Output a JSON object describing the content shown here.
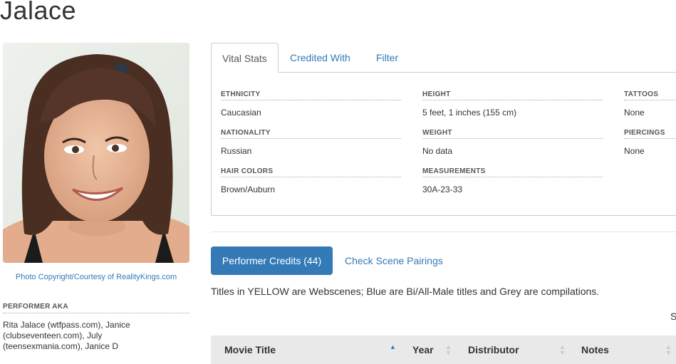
{
  "page": {
    "title": "Jalace"
  },
  "photo": {
    "credit": "Photo Copyright/Courtesy of RealityKings.com"
  },
  "aka": {
    "heading": "PERFORMER AKA",
    "text": "Rita Jalace (wtfpass.com), Janice (clubseventeen.com), July (teensexmania.com), Janice D"
  },
  "tabs": [
    "Vital Stats",
    "Credited With",
    "Filter"
  ],
  "vital_stats": {
    "ethnicity": {
      "label": "ETHNICITY",
      "value": "Caucasian"
    },
    "nationality": {
      "label": "NATIONALITY",
      "value": "Russian"
    },
    "hair_colors": {
      "label": "HAIR COLORS",
      "value": "Brown/Auburn"
    },
    "height": {
      "label": "HEIGHT",
      "value": "5 feet, 1 inches (155 cm)"
    },
    "weight": {
      "label": "WEIGHT",
      "value": "No data"
    },
    "measurements": {
      "label": "MEASUREMENTS",
      "value": "30A-23-33"
    },
    "tattoos": {
      "label": "TATTOOS",
      "value": "None"
    },
    "piercings": {
      "label": "PIERCINGS",
      "value": "None"
    }
  },
  "credits": {
    "button": "Performer Credits (44)",
    "pairings_link": "Check Scene Pairings",
    "note": "Titles in YELLOW are Webscenes; Blue are Bi/All-Male titles and Grey are compilations.",
    "cutoff_text": "S"
  },
  "table": {
    "columns": [
      "Movie Title",
      "Year",
      "Distributor",
      "Notes"
    ]
  },
  "colors": {
    "accent": "#337ab7",
    "header_bg": "#e9e9e9"
  }
}
